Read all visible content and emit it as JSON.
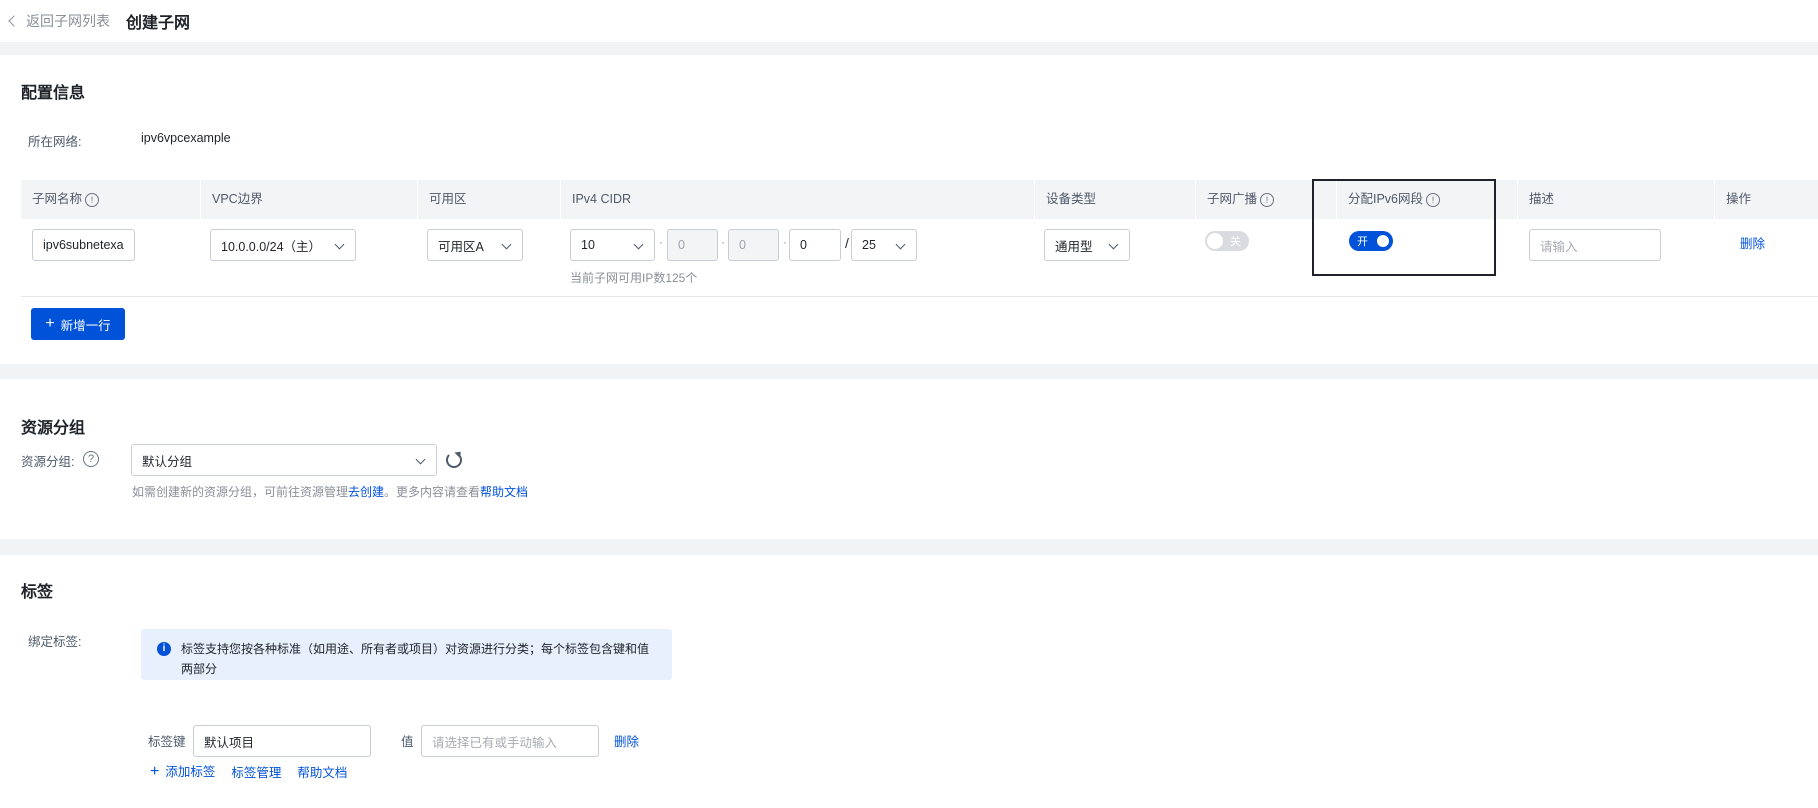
{
  "header": {
    "back_label": "返回子网列表",
    "title": "创建子网"
  },
  "config": {
    "section_title": "配置信息",
    "network_label": "所在网络:",
    "network_value": "ipv6vpcexample",
    "columns": {
      "name": "子网名称",
      "vpc_border": "VPC边界",
      "zone": "可用区",
      "ipv4": "IPv4 CIDR",
      "device": "设备类型",
      "broadcast": "子网广播",
      "ipv6": "分配IPv6网段",
      "desc": "描述",
      "ops": "操作"
    },
    "row": {
      "name": "ipv6subnetexa",
      "vpc_border": "10.0.0.0/24（主）",
      "zone": "可用区A",
      "ip1": "10",
      "ip2": "0",
      "ip3": "0",
      "ip4": "0",
      "slash": "/",
      "mask": "25",
      "ip_hint": "当前子网可用IP数125个",
      "device": "通用型",
      "broadcast_text": "关",
      "broadcast_on": false,
      "ipv6_text": "开",
      "ipv6_on": true,
      "desc_placeholder": "请输入",
      "delete": "删除"
    },
    "add_row": "新增一行"
  },
  "resource": {
    "section_title": "资源分组",
    "label": "资源分组:",
    "value": "默认分组",
    "hint_prefix": "如需创建新的资源分组，可前往资源管理",
    "hint_link1": "去创建",
    "hint_mid": "。更多内容请查看",
    "hint_link2": "帮助文档"
  },
  "tags": {
    "section_title": "标签",
    "label": "绑定标签:",
    "notice_line1": "标签支持您按各种标准（如用途、所有者或项目）对资源进行分类；每个标签包含键和值",
    "notice_line2": "两部分",
    "key_label": "标签键",
    "key_value": "默认项目",
    "value_label": "值",
    "value_placeholder": "请选择已有或手动输入",
    "delete": "删除",
    "add_tag": "添加标签",
    "manage": "标签管理",
    "help": "帮助文档"
  }
}
